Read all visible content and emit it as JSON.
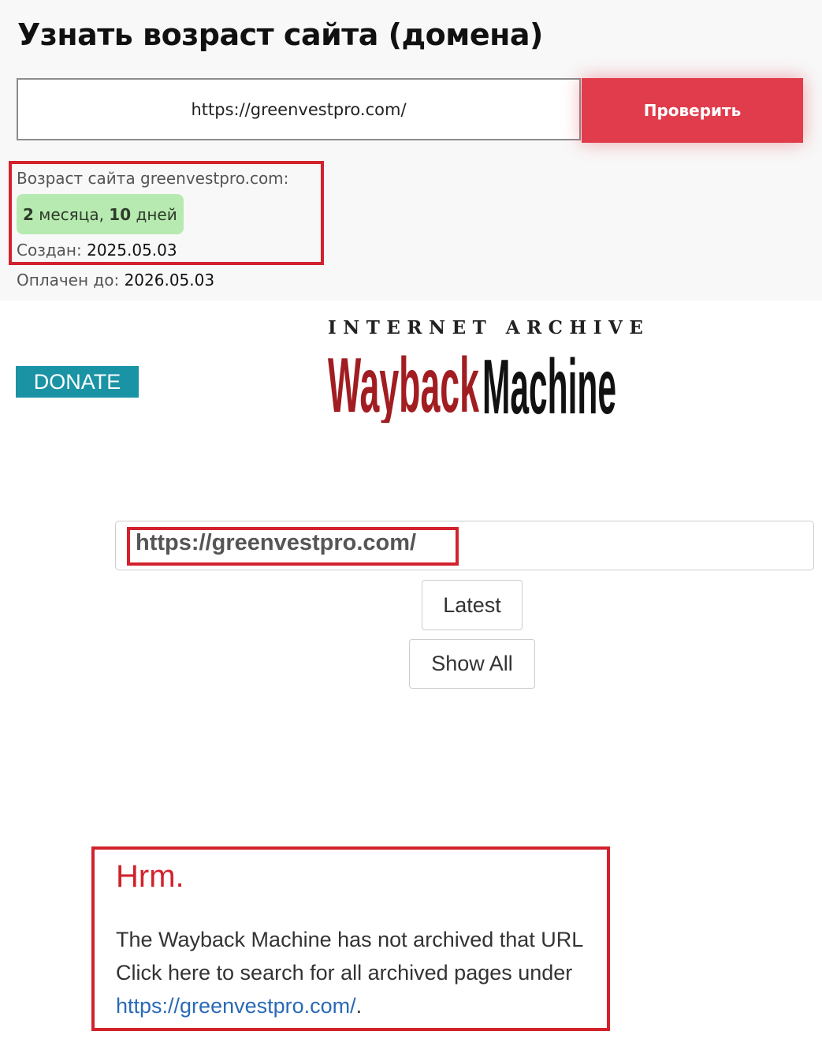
{
  "age_checker": {
    "title": "Узнать возраст сайта (домена)",
    "input_value": "https://greenvestpro.com/",
    "check_button": "Проверить",
    "result": {
      "age_label": "Возраст сайта greenvestpro.com:",
      "months_num": "2",
      "months_word": "месяца,",
      "days_num": "10",
      "days_word": "дней",
      "created_label": "Создан:",
      "created_value": "2025.05.03",
      "paid_label": "Оплачен до:",
      "paid_value": "2026.05.03"
    }
  },
  "wayback": {
    "donate_label": "DONATE",
    "header_text": "INTERNET ARCHIVE",
    "logo_word_1": "Wayback",
    "logo_word_2": "Machine",
    "url_value": "https://greenvestpro.com/",
    "latest_button": "Latest",
    "show_all_button": "Show All",
    "message": {
      "heading": "Hrm.",
      "line_1": "The Wayback Machine has not archived that URL",
      "line_2": "Click here to search for all archived pages under",
      "link": "https://greenvestpro.com/",
      "link_suffix": "."
    }
  },
  "colors": {
    "check_button": "#e03c4b",
    "age_badge": "#b7eab0",
    "highlight_box": "#d2222d",
    "donate": "#1a93a5",
    "logo_red": "#a11d21",
    "logo_black": "#111111",
    "link": "#2a6ab5"
  }
}
